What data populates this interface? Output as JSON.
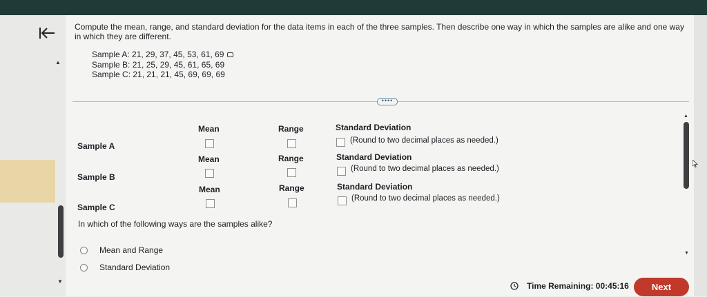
{
  "question": {
    "text": "Compute the mean, range, and standard deviation for the data items in each of the three samples. Then describe one way in which the samples are alike and one way in which they are different."
  },
  "samples": [
    {
      "label": "Sample A: 21, 29, 37, 45, 53, 61, 69"
    },
    {
      "label": "Sample B: 21, 25, 29, 45, 61, 65, 69"
    },
    {
      "label": "Sample C: 21, 21, 21, 45, 69, 69, 69"
    }
  ],
  "more_indicator": "••••",
  "table": {
    "rows": [
      {
        "name": "Sample A",
        "mean_label": "Mean",
        "range_label": "Range",
        "sd_label": "Standard Deviation",
        "note": "(Round to two decimal places as needed.)"
      },
      {
        "name": "Sample B",
        "mean_label": "Mean",
        "range_label": "Range",
        "sd_label": "Standard Deviation",
        "note": "(Round to two decimal places as needed.)"
      },
      {
        "name": "Sample C",
        "mean_label": "Mean",
        "range_label": "Range",
        "sd_label": "Standard Deviation",
        "note": "(Round to two decimal places as needed.)"
      }
    ]
  },
  "alike_question": "In which of the following ways are the samples alike?",
  "options": [
    {
      "label": "Mean and Range"
    },
    {
      "label": "Standard Deviation"
    }
  ],
  "footer": {
    "time_label": "Time Remaining: 00:45:16",
    "next_label": "Next"
  },
  "colors": {
    "next_button": "#c0392b",
    "top_bar": "#1f3a37",
    "more_pill_border": "#6a88a8"
  },
  "icons": [
    "back-to-start-icon",
    "copy-data-icon",
    "clock-icon",
    "mouse-cursor-icon"
  ]
}
